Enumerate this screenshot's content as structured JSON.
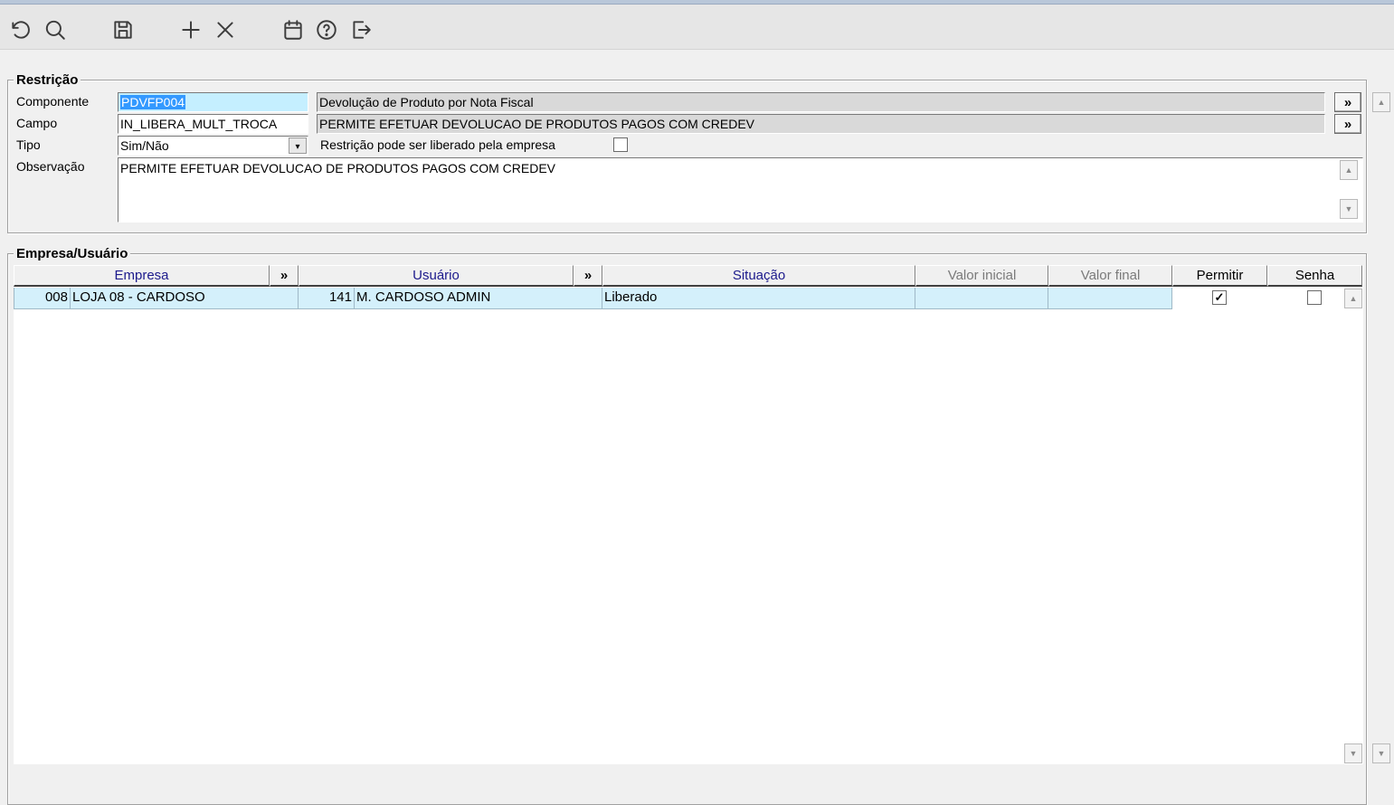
{
  "toolbar": {
    "icons": [
      "undo-icon",
      "search-icon",
      "save-icon",
      "add-icon",
      "delete-icon",
      "calendar-icon",
      "help-icon",
      "exit-icon"
    ]
  },
  "restricao": {
    "legend": "Restrição",
    "componente_label": "Componente",
    "componente_value": "PDVFP004",
    "componente_desc": "Devolução de Produto por Nota Fiscal",
    "campo_label": "Campo",
    "campo_value": "IN_LIBERA_MULT_TROCA",
    "campo_desc": "PERMITE EFETUAR DEVOLUCAO DE PRODUTOS PAGOS COM CREDEV",
    "tipo_label": "Tipo",
    "tipo_value": "Sim/Não",
    "liberado_empresa_label": "Restrição pode ser liberado pela empresa",
    "liberado_empresa_checked": false,
    "observacao_label": "Observação",
    "observacao_value": "PERMITE EFETUAR DEVOLUCAO DE PRODUTOS PAGOS COM CREDEV",
    "lookup_button": "»"
  },
  "empresa_usuario": {
    "legend": "Empresa/Usuário",
    "columns": {
      "empresa": "Empresa",
      "usuario": "Usuário",
      "situacao": "Situação",
      "valor_inicial": "Valor inicial",
      "valor_final": "Valor final",
      "permitir": "Permitir",
      "senha": "Senha",
      "lookup": "»"
    },
    "rows": [
      {
        "empresa_cod": "008",
        "empresa_nome": "LOJA 08 - CARDOSO",
        "usuario_cod": "141",
        "usuario_nome": "M. CARDOSO ADMIN",
        "situacao": "Liberado",
        "valor_inicial": "",
        "valor_final": "",
        "permitir": true,
        "senha": false
      }
    ]
  },
  "colors": {
    "active_field": "#c5efff",
    "selected_row": "#d4f0fb",
    "header_blue": "#1c1a8c"
  }
}
